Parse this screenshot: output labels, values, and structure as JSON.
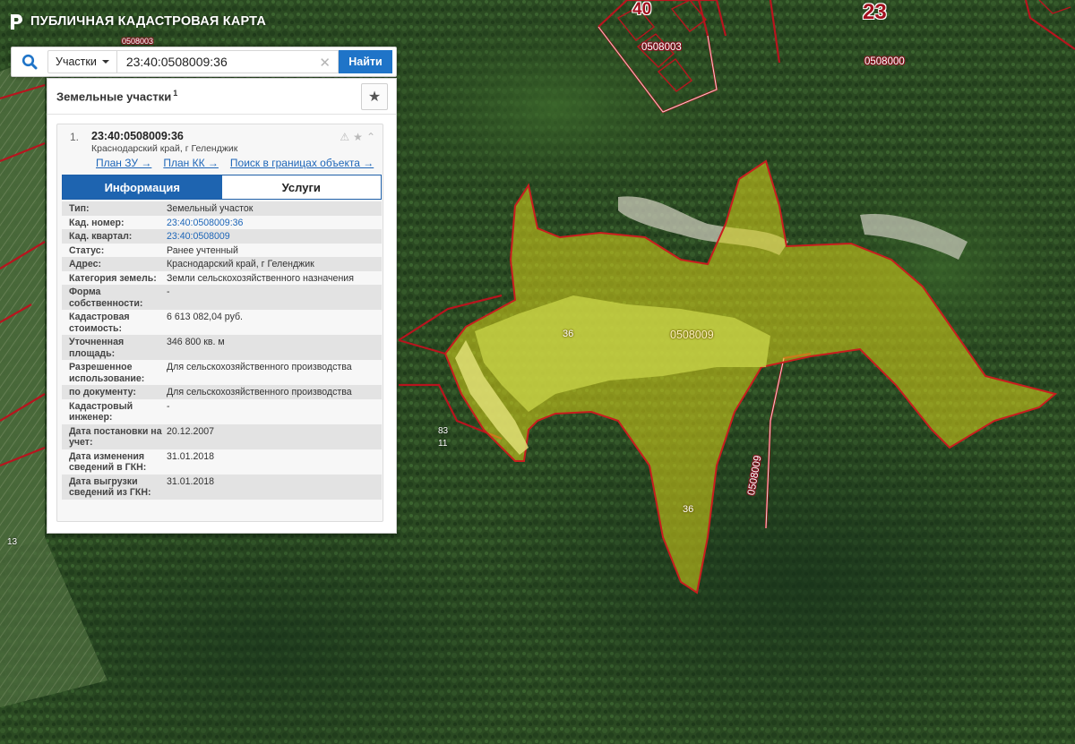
{
  "header": {
    "title": "ПУБЛИЧНАЯ КАДАСТРОВАЯ КАРТА"
  },
  "search": {
    "type_label": "Участки",
    "query": "23:40:0508009:36",
    "find_label": "Найти"
  },
  "panel": {
    "title": "Земельные участки",
    "count": "1",
    "result": {
      "index": "1.",
      "cadastral_number": "23:40:0508009:36",
      "address": "Краснодарский край, г Геленджик",
      "links": [
        "План ЗУ →",
        "План КК →",
        "Поиск в границах объекта →"
      ],
      "tabs": [
        "Информация",
        "Услуги"
      ],
      "info": [
        {
          "key": "Тип:",
          "value": "Земельный участок"
        },
        {
          "key": "Кад. номер:",
          "value": "23:40:0508009:36"
        },
        {
          "key": "Кад. квартал:",
          "value": "23:40:0508009"
        },
        {
          "key": "Статус:",
          "value": "Ранее учтенный"
        },
        {
          "key": "Адрес:",
          "value": "Краснодарский край, г Геленджик"
        },
        {
          "key": "Категория земель:",
          "value": "Земли сельскохозяйственного назначения"
        },
        {
          "key": "Форма собственности:",
          "value": "-"
        },
        {
          "key": "Кадастровая стоимость:",
          "value": "6 613 082,04 руб."
        },
        {
          "key": "Уточненная площадь:",
          "value": "346 800 кв. м"
        },
        {
          "key": "Разрешенное использование:",
          "value": "Для сельскохозяйственного производства"
        },
        {
          "key": "по документу:",
          "value": "Для сельскохозяйственного производства"
        },
        {
          "key": "Кадастровый инженер:",
          "value": "-"
        },
        {
          "key": "Дата постановки на учет:",
          "value": "20.12.2007"
        },
        {
          "key": "Дата изменения сведений в ГКН:",
          "value": "31.01.2018"
        },
        {
          "key": "Дата выгрузки сведений из ГКН:",
          "value": "31.01.2018"
        }
      ]
    }
  },
  "map_labels": {
    "quarter_top_a": "0508003",
    "quarter_top_b": "0508000",
    "quarter_center": "0508009",
    "quarter_vertical": "0508009",
    "big_40": "40",
    "big_23": "23",
    "parcel_36_a": "36",
    "parcel_36_b": "36",
    "small_83": "83",
    "small_11": "11",
    "small_13": "13",
    "tiny_top": "0508003"
  },
  "colors": {
    "parcel_fill": "#d8d21a",
    "parcel_border": "#c81e1e",
    "quarter_border": "#b8141e",
    "accent": "#1f74c8"
  },
  "icons": {
    "logo": "rosreestr-logo-icon",
    "search": "search-icon",
    "clear": "clear-icon",
    "favorite": "star-icon",
    "warning": "warning-icon",
    "card_star": "star-icon",
    "collapse": "chevron-up-icon"
  }
}
